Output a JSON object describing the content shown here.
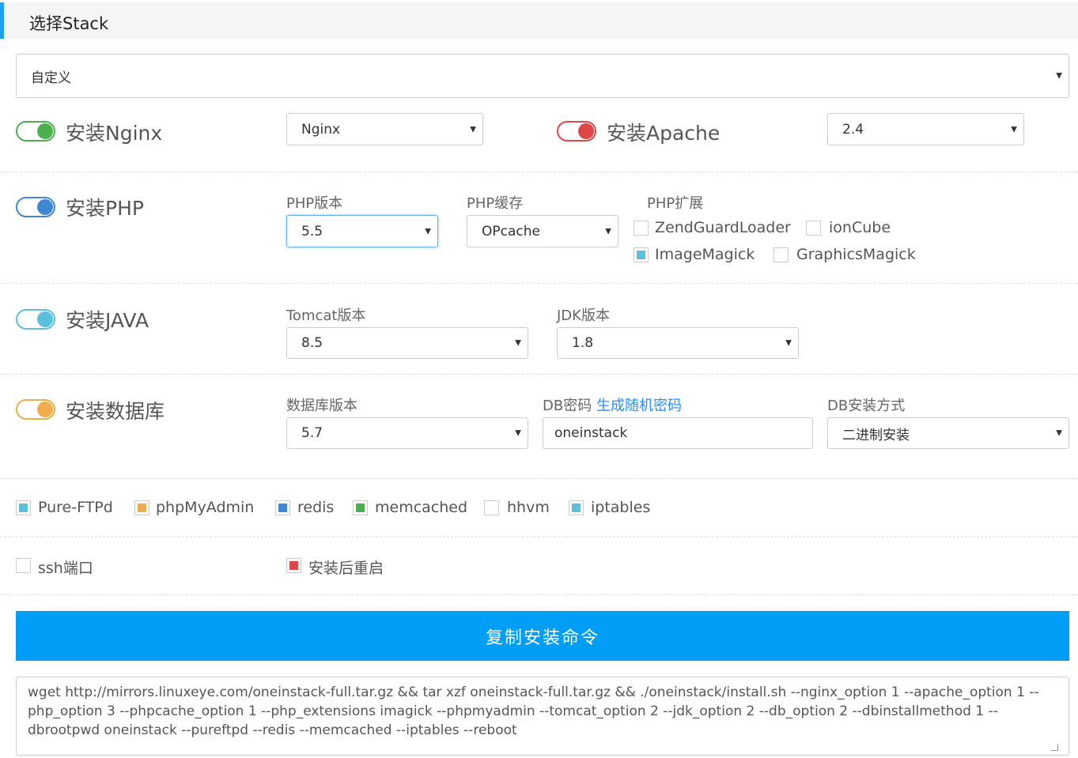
{
  "header": {
    "title": "选择Stack"
  },
  "stack_select": {
    "value": "自定义"
  },
  "nginx": {
    "label": "安装Nginx",
    "version": "Nginx",
    "color": "#4caf50"
  },
  "apache": {
    "label": "安装Apache",
    "version": "2.4",
    "color": "#e04646"
  },
  "php": {
    "label": "安装PHP",
    "color": "#3f87d3",
    "version_label": "PHP版本",
    "version": "5.5",
    "cache_label": "PHP缓存",
    "cache": "OPcache",
    "ext_label": "PHP扩展",
    "extensions": [
      {
        "name": "ZendGuardLoader",
        "checked": false
      },
      {
        "name": "ionCube",
        "checked": false
      },
      {
        "name": "ImageMagick",
        "checked": true
      },
      {
        "name": "GraphicsMagick",
        "checked": false
      }
    ]
  },
  "java": {
    "label": "安装JAVA",
    "color": "#5bc0de",
    "tomcat_label": "Tomcat版本",
    "tomcat": "8.5",
    "jdk_label": "JDK版本",
    "jdk": "1.8"
  },
  "db": {
    "label": "安装数据库",
    "color": "#f0ad4e",
    "version_label": "数据库版本",
    "version": "5.7",
    "pwd_label": "DB密码",
    "gen_link": "生成随机密码",
    "pwd": "oneinstack",
    "method_label": "DB安装方式",
    "method": "二进制安装"
  },
  "options": [
    {
      "name": "Pure-FTPd",
      "color": "#5bc0de"
    },
    {
      "name": "phpMyAdmin",
      "color": "#f0ad4e"
    },
    {
      "name": "redis",
      "color": "#3f87d3"
    },
    {
      "name": "memcached",
      "color": "#4caf50"
    },
    {
      "name": "hhvm",
      "color": ""
    },
    {
      "name": "iptables",
      "color": "#5bc0de"
    }
  ],
  "extra": {
    "ssh": "ssh端口",
    "reboot": "安装后重启",
    "reboot_color": "#e04646"
  },
  "copy_button": "复制安装命令",
  "command": "wget http://mirrors.linuxeye.com/oneinstack-full.tar.gz && tar xzf oneinstack-full.tar.gz && ./oneinstack/install.sh --nginx_option 1 --apache_option 1 --php_option 3 --phpcache_option 1 --php_extensions imagick --phpmyadmin  --tomcat_option 2 --jdk_option 2 --db_option 2 --dbinstallmethod 1 --dbrootpwd oneinstack --pureftpd  --redis  --memcached  --iptables  --reboot"
}
